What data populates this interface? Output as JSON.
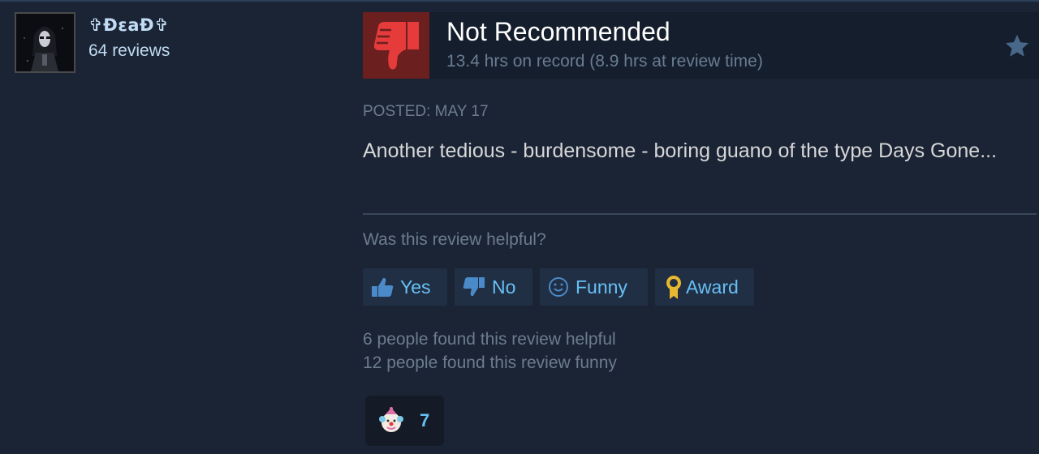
{
  "author": {
    "name": "✞ĐεaĐ✞",
    "reviews": "64 reviews"
  },
  "review": {
    "recommendation": "Not Recommended",
    "hours": "13.4 hrs on record (8.9 hrs at review time)",
    "posted": "POSTED: MAY 17",
    "content": "Another tedious - burdensome - boring guano of the type Days Gone..."
  },
  "feedback": {
    "question": "Was this review helpful?",
    "buttons": {
      "yes": "Yes",
      "no": "No",
      "funny": "Funny",
      "award": "Award"
    },
    "helpful_count": "6 people found this review helpful",
    "funny_count": "12 people found this review funny"
  },
  "reaction": {
    "icon": "clown-face-icon",
    "count": "7"
  },
  "colors": {
    "background": "#1b2434",
    "header_bar": "#151e2c",
    "thumb_bg": "#6c1f1f",
    "thumb_icon": "#e53b3b",
    "accent": "#66c0f4",
    "button_bg": "#212f44",
    "award_gold": "#e8b830"
  }
}
